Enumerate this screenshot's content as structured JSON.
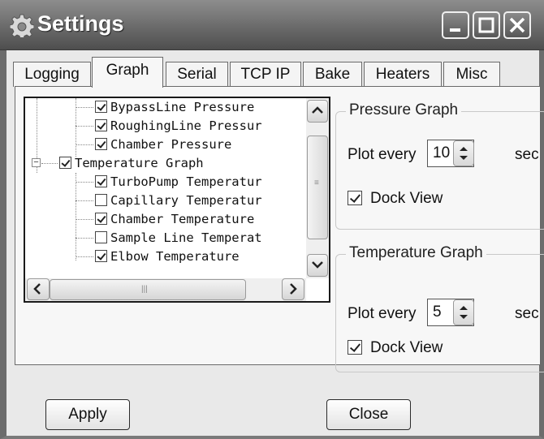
{
  "window": {
    "title": "Settings"
  },
  "tabs": [
    "Logging",
    "Graph",
    "Serial",
    "TCP IP",
    "Bake",
    "Heaters",
    "Misc"
  ],
  "active_tab": "Graph",
  "tree": {
    "items": [
      {
        "label": "BypassLine Pressure",
        "checked": true,
        "level": 2
      },
      {
        "label": "RoughingLine Pressur",
        "checked": true,
        "level": 2
      },
      {
        "label": "Chamber Pressure",
        "checked": true,
        "level": 2
      },
      {
        "label": "Temperature Graph",
        "checked": true,
        "level": 1,
        "expanded": true
      },
      {
        "label": "TurboPump Temperatur",
        "checked": true,
        "level": 2
      },
      {
        "label": "Capillary Temperatur",
        "checked": false,
        "level": 2
      },
      {
        "label": "Chamber Temperature",
        "checked": true,
        "level": 2
      },
      {
        "label": "Sample Line Temperat",
        "checked": false,
        "level": 2
      },
      {
        "label": "Elbow Temperature",
        "checked": true,
        "level": 2
      }
    ]
  },
  "pressure_graph": {
    "title": "Pressure Graph",
    "plot_label": "Plot every",
    "value": "10",
    "unit": "sec",
    "dock_view_label": "Dock View",
    "dock_view_checked": true
  },
  "temperature_graph": {
    "title": "Temperature Graph",
    "plot_label": "Plot every",
    "value": "5",
    "unit": "sec",
    "dock_view_label": "Dock View",
    "dock_view_checked": true
  },
  "buttons": {
    "apply": "Apply",
    "close": "Close"
  }
}
